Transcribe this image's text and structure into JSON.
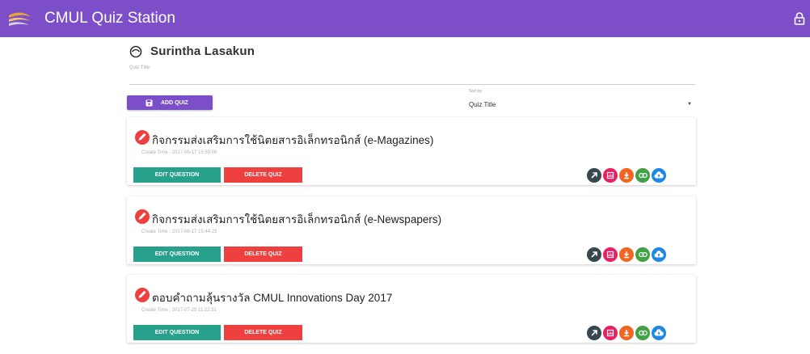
{
  "app": {
    "title": "CMUL Quiz Station",
    "logo_icon": "cmul-logo-icon",
    "lock_icon": "lock-icon"
  },
  "user": {
    "name": "Surintha Lasakun",
    "icon": "user-icon"
  },
  "quiz_title_field": {
    "label": "Quiz Title",
    "value": ""
  },
  "add_quiz_button": {
    "label": "ADD QUIZ",
    "icon": "floppy-icon"
  },
  "sort": {
    "label": "Sort by",
    "selected": "Quiz Title"
  },
  "colors": {
    "primary": "#7c4fc9",
    "edit": "#27a08c",
    "delete": "#ef4040",
    "action_share": "#37474f",
    "action_report": "#e91e63",
    "action_download": "#f26522",
    "action_link": "#43a047",
    "action_upload": "#1e88e5"
  },
  "quizzes": [
    {
      "title": "กิจกรรมส่งเสริมการใช้นิตยสารอิเล็กทรอนิกส์ (e-Magazines)",
      "create_time": "Create Time : 2017-06-17 15:39:00",
      "edit_label": "EDIT QUESTION",
      "delete_label": "DELETE QUIZ"
    },
    {
      "title": "กิจกรรมส่งเสริมการใช้นิตยสารอิเล็กทรอนิกส์ (e-Newspapers)",
      "create_time": "Create Time : 2017-06-17 15:44:23",
      "edit_label": "EDIT QUESTION",
      "delete_label": "DELETE QUIZ"
    },
    {
      "title": "ตอบคำถามลุ้นรางวัล CMUL Innovations Day 2017",
      "create_time": "Create Time : 2017-07-25 11:22:31",
      "edit_label": "EDIT QUESTION",
      "delete_label": "DELETE QUIZ"
    }
  ]
}
